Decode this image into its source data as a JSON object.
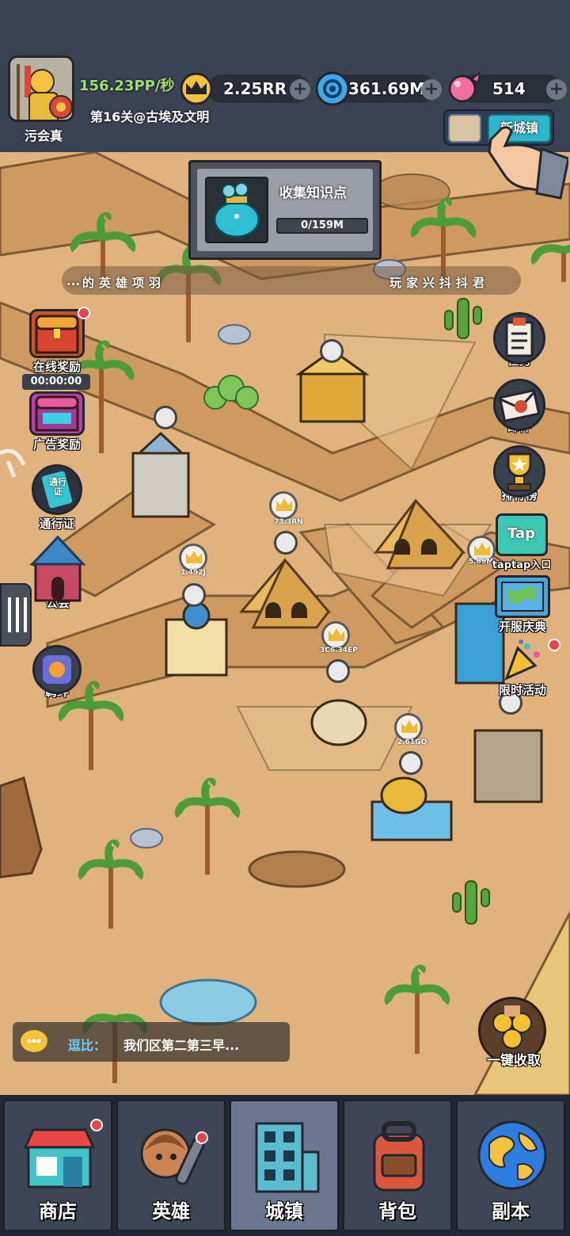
{
  "player": {
    "name": "污会真",
    "pp_rate": "156.23PP/秒",
    "level": "第16关@古埃及文明"
  },
  "resources": {
    "crown_value": "2.25RR",
    "gem_value": "361.69M",
    "candy_value": "514"
  },
  "new_town": {
    "label": "新城镇"
  },
  "collect": {
    "title": "收集知识点",
    "progress_text": "0/159M",
    "progress_fraction": 0
  },
  "marquee": {
    "left_text": "的英雄项羽",
    "left_prefix": "...",
    "right_text": "玩家兴抖抖君"
  },
  "side_left": {
    "online_reward": "在线奖励",
    "online_timer": "00:00:00",
    "ad_reward": "广告奖励",
    "pass": "通行证",
    "pass_icon_text": "通行证",
    "guild": "公会",
    "bond": "羁绊"
  },
  "side_right": {
    "tasks": "任务",
    "mail": "邮件",
    "ranking": "排行榜",
    "taptap": "taptap入口",
    "taptap_icon": "Tap",
    "server_event": "开服庆典",
    "limited_event": "限时活动",
    "collect_all": "一键收取"
  },
  "map_badges": {
    "b1": "73.3RN",
    "b2": "1.492J",
    "b3": "3C6.34EP",
    "b4": "2.61GQ",
    "b5": "5.89M"
  },
  "chat": {
    "sender": "逗比：",
    "message": "我们区第二第三早..."
  },
  "nav": {
    "shop": "商店",
    "heroes": "英雄",
    "town": "城镇",
    "bag": "背包",
    "dungeon": "副本"
  },
  "colors": {
    "sand": "#dfb27e",
    "road": "#c9955f",
    "accent_teal": "#2fb6c9",
    "pp_green": "#9be36e",
    "topbar": "#3b4252"
  }
}
